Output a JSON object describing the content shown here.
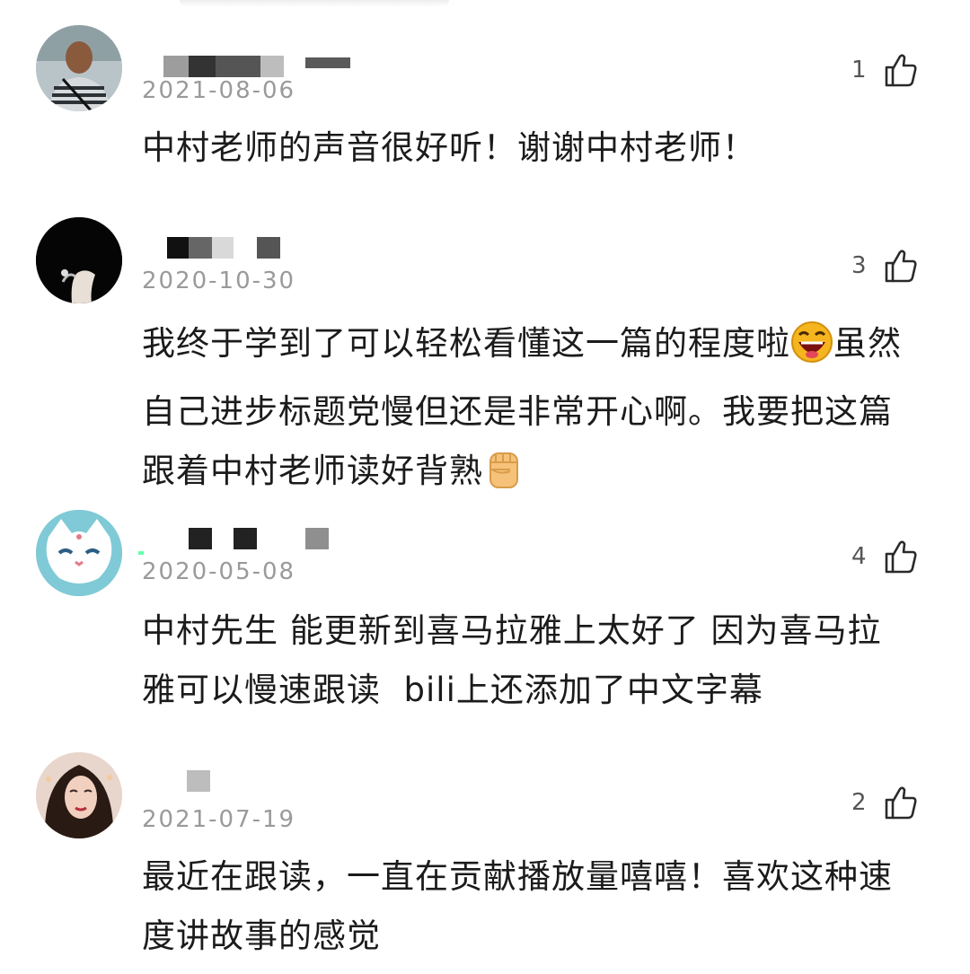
{
  "comments": [
    {
      "date": "2021-08-06",
      "likes": "1",
      "text": "中村老师的声音很好听！谢谢中村老师！"
    },
    {
      "date": "2020-10-30",
      "likes": "3",
      "text_line1": "我终于学到了可以轻松看懂这一篇的程度啦",
      "text_line1b": "虽然",
      "text_line2": "自己进步标题党慢但还是非常开心啊。我要把这篇",
      "text_line3": "跟着中村老师读好背熟"
    },
    {
      "date": "2020-05-08",
      "likes": "4",
      "text_line1": "中村先生 能更新到喜马拉雅上太好了 因为喜马拉",
      "text_line2": "雅可以慢速跟读  bili上还添加了中文字幕"
    },
    {
      "date": "2021-07-19",
      "likes": "2",
      "text_line1": "最近在跟读，一直在贡献播放量嘻嘻！喜欢这种速",
      "text_line2": "度讲故事的感觉"
    }
  ],
  "icons": {
    "like": "thumbs-up-outline-icon",
    "emoji_laugh": "laughing-emoji-icon",
    "emoji_fist": "raised-fist-emoji-icon"
  },
  "colors": {
    "text": "#1b1b1b",
    "date": "#9a9a9a",
    "like_count": "#555555"
  }
}
